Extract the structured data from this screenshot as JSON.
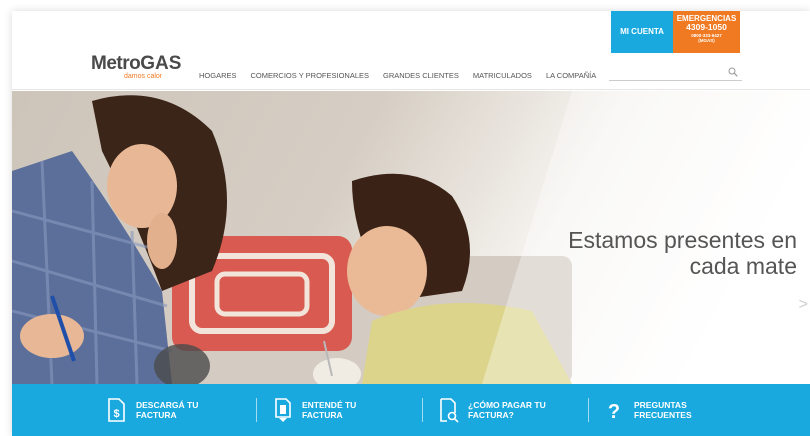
{
  "header": {
    "logo": {
      "word_main": "Metro",
      "word_gas": "GAS",
      "tagline": "damos calor"
    },
    "cuenta_label": "MI CUENTA",
    "emergencias": {
      "title": "EMERGENCIAS",
      "phone": "4309-1050",
      "alt_phone": "0800-333-6427",
      "alt_text": "(MGAS)"
    },
    "nav": [
      "HOGARES",
      "COMERCIOS Y PROFESIONALES",
      "GRANDES CLIENTES",
      "MATRICULADOS",
      "LA COMPAÑÍA"
    ],
    "search": {
      "placeholder": ""
    }
  },
  "hero": {
    "title_line1": "Estamos presentes en",
    "title_line2": "cada mate",
    "next_glyph": ">"
  },
  "bar": {
    "items": [
      {
        "label": "DESCARGÁ TU\nFACTURA",
        "icon": "invoice-download-icon"
      },
      {
        "label": "ENTENDÉ TU\nFACTURA",
        "icon": "invoice-info-icon"
      },
      {
        "label": "¿CÓMO PAGAR TU\nFACTURA?",
        "icon": "invoice-search-icon"
      },
      {
        "label": "PREGUNTAS\nFRECUENTES",
        "icon": "question-icon"
      }
    ]
  },
  "colors": {
    "brand_blue": "#1aa9df",
    "brand_orange": "#f07a22"
  }
}
